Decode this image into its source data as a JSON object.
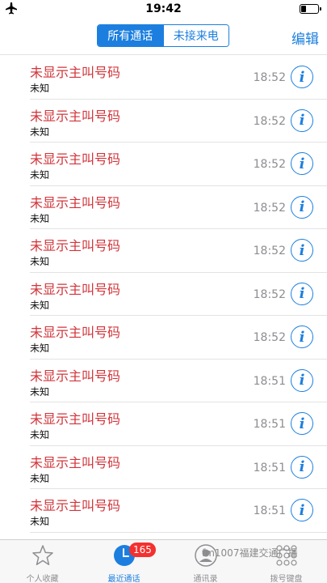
{
  "status_bar": {
    "time": "19:42",
    "airplane_icon": "airplane-icon",
    "battery_icon": "battery-icon"
  },
  "nav": {
    "segments": [
      {
        "label": "所有通话",
        "active": true
      },
      {
        "label": "未接来电",
        "active": false
      }
    ],
    "edit_label": "编辑"
  },
  "colors": {
    "accent": "#1c7fdf",
    "missed_call_red": "#d2343a",
    "badge_red": "#f4312f",
    "secondary_gray": "#8e8e93"
  },
  "calls": [
    {
      "caller": "未显示主叫号码",
      "type": "未知",
      "time": "18:52"
    },
    {
      "caller": "未显示主叫号码",
      "type": "未知",
      "time": "18:52"
    },
    {
      "caller": "未显示主叫号码",
      "type": "未知",
      "time": "18:52"
    },
    {
      "caller": "未显示主叫号码",
      "type": "未知",
      "time": "18:52"
    },
    {
      "caller": "未显示主叫号码",
      "type": "未知",
      "time": "18:52"
    },
    {
      "caller": "未显示主叫号码",
      "type": "未知",
      "time": "18:52"
    },
    {
      "caller": "未显示主叫号码",
      "type": "未知",
      "time": "18:52"
    },
    {
      "caller": "未显示主叫号码",
      "type": "未知",
      "time": "18:51"
    },
    {
      "caller": "未显示主叫号码",
      "type": "未知",
      "time": "18:51"
    },
    {
      "caller": "未显示主叫号码",
      "type": "未知",
      "time": "18:51"
    },
    {
      "caller": "未显示主叫号码",
      "type": "未知",
      "time": "18:51"
    }
  ],
  "tab_bar": {
    "tabs": [
      {
        "label": "个人收藏",
        "icon": "star-icon",
        "active": false
      },
      {
        "label": "最近通话",
        "icon": "clock-icon",
        "active": true,
        "badge": "165"
      },
      {
        "label": "通讯录",
        "icon": "contact-icon",
        "active": false
      },
      {
        "label": "拨号键盘",
        "icon": "keypad-icon",
        "active": false
      }
    ],
    "watermark": "fm1007福建交通广播"
  }
}
